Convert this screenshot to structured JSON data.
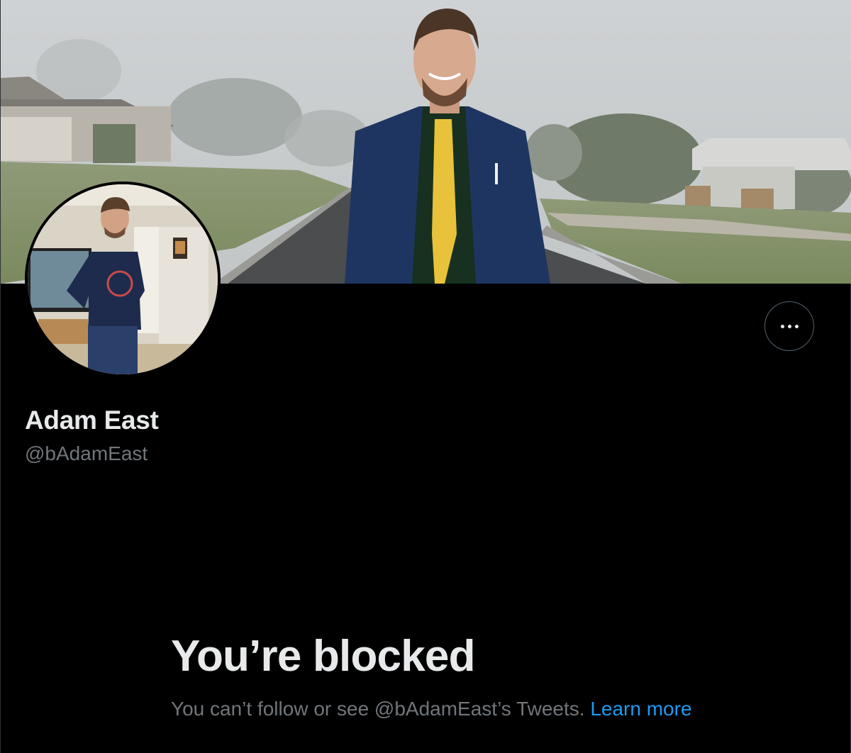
{
  "profile": {
    "display_name": "Adam East",
    "handle": "@bAdamEast"
  },
  "blocked": {
    "title": "You’re blocked",
    "message": "You can’t follow or see @bAdamEast’s Tweets.",
    "learn_more": "Learn more"
  },
  "icons": {
    "more": "more-horizontal-icon"
  },
  "colors": {
    "background": "#000000",
    "primary_text": "#e7e9ea",
    "secondary_text": "#71767b",
    "link": "#1d9bf0",
    "button_border": "#536471"
  }
}
